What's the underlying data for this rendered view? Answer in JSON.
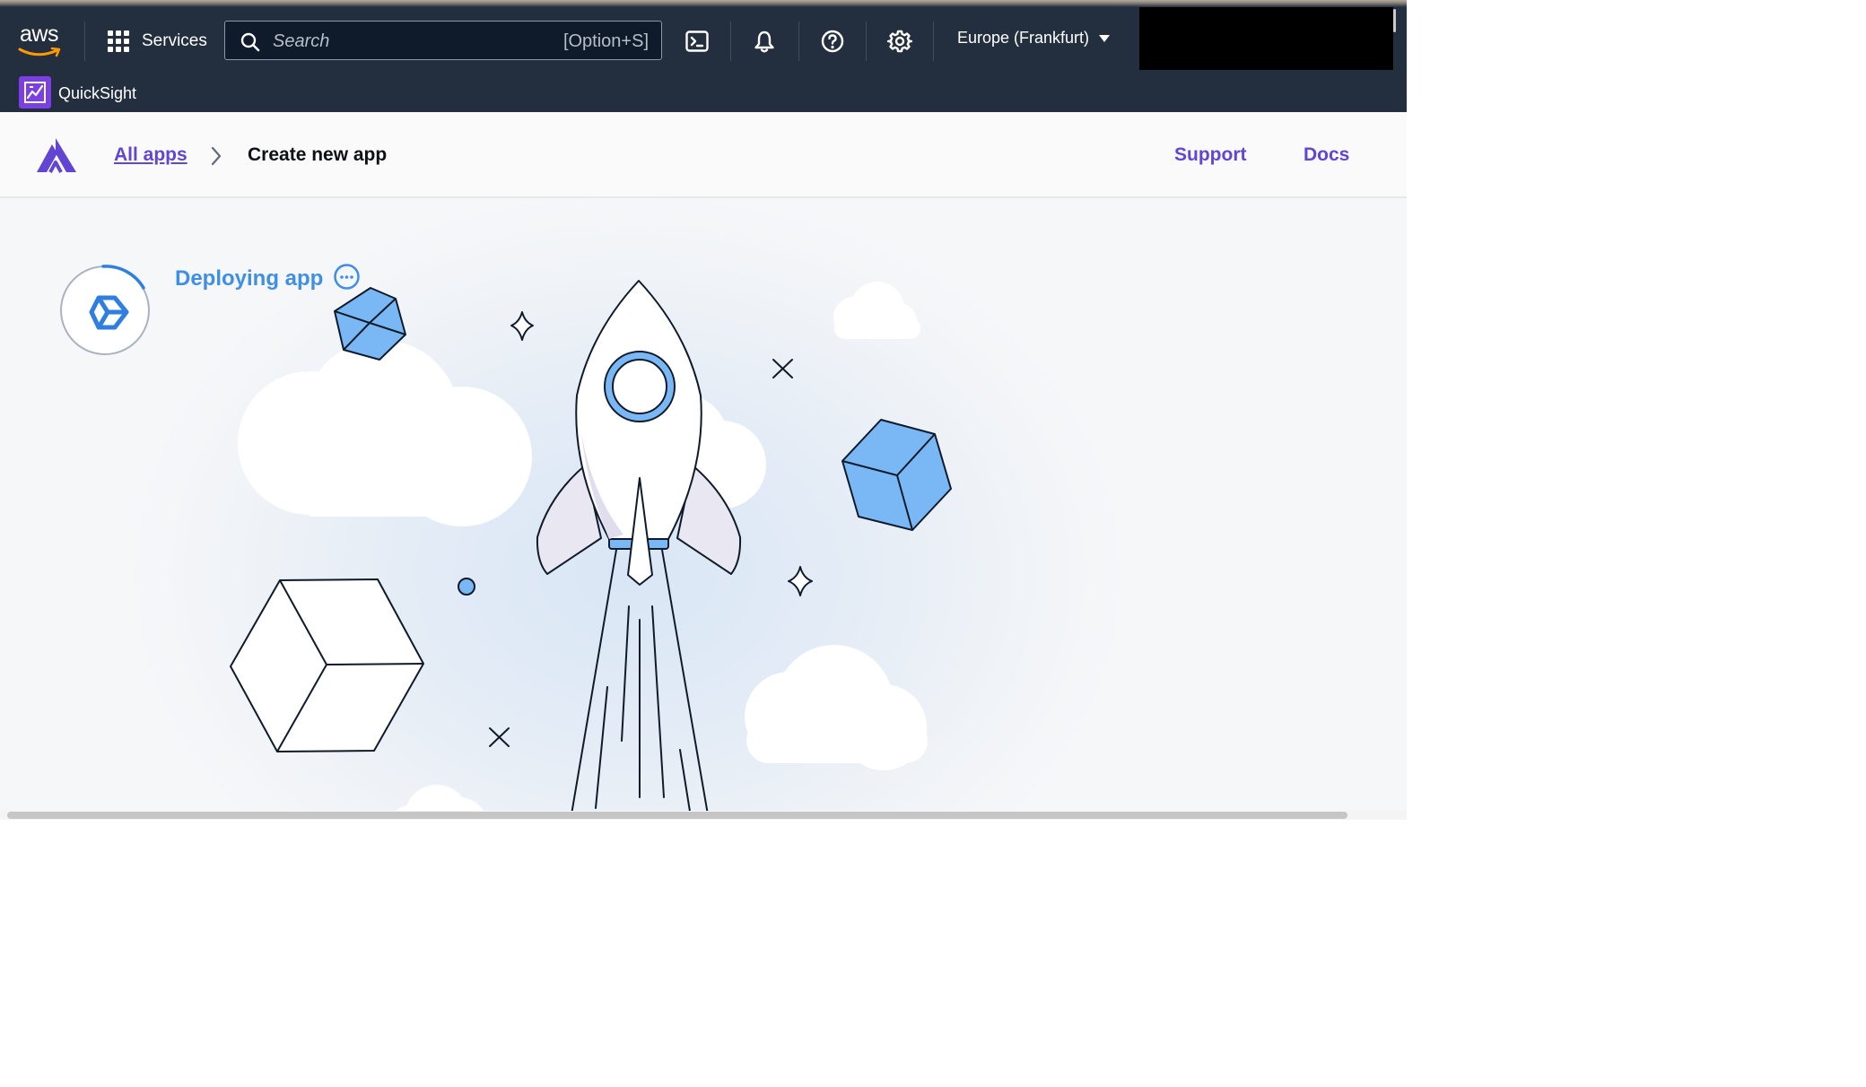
{
  "aws_nav": {
    "logo_text": "aws",
    "services_label": "Services",
    "search": {
      "placeholder": "Search",
      "shortcut": "[Option+S]"
    },
    "icons": [
      "cloudshell-icon",
      "bell-icon",
      "help-icon",
      "gear-icon"
    ],
    "region": "Europe (Frankfurt)",
    "service_label": "QuickSight"
  },
  "app_header": {
    "breadcrumb_link": "All apps",
    "breadcrumb_current": "Create new app",
    "support_label": "Support",
    "docs_label": "Docs"
  },
  "status": {
    "text": "Deploying app",
    "icon": "cube-outline-icon",
    "more_icon": "ellipsis-circle-icon"
  },
  "illustration": {
    "subject": "rocket-launch",
    "colors": {
      "accent_blue": "#7ab8f5",
      "stroke": "#0f1b2a",
      "cloud": "#ffffff"
    }
  },
  "colors": {
    "aws_nav_bg": "#232f3e",
    "amplify_purple": "#6245d3",
    "status_blue": "#3f8ee8"
  }
}
